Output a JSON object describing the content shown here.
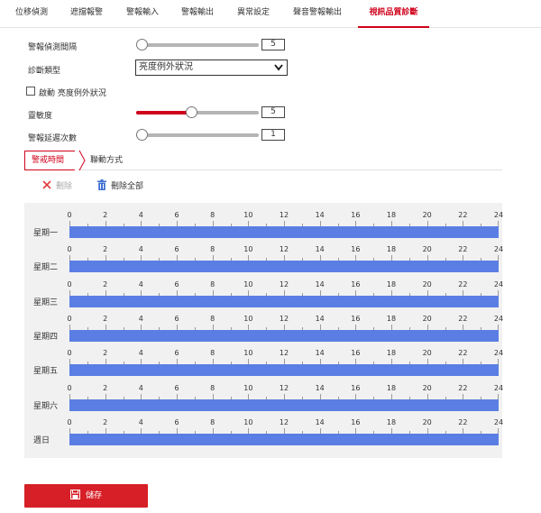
{
  "tabs": [
    {
      "label": "位移偵測",
      "active": false
    },
    {
      "label": "遮擋報警",
      "active": false
    },
    {
      "label": "警報輸入",
      "active": false
    },
    {
      "label": "警報輸出",
      "active": false
    },
    {
      "label": "異常設定",
      "active": false
    },
    {
      "label": "聲音警報輸出",
      "active": false
    },
    {
      "label": "視訊品質診斷",
      "active": true
    }
  ],
  "form": {
    "interval": {
      "label": "警報偵測間隔",
      "value": "5"
    },
    "diag_type": {
      "label": "診斷類型",
      "selected": "亮度例外狀況"
    },
    "enable": {
      "label": "啟動 亮度例外狀況",
      "checked": false
    },
    "sensitivity": {
      "label": "靈敏度",
      "value": "5"
    },
    "delay": {
      "label": "警報延遲次數",
      "value": "1"
    }
  },
  "subtabs": {
    "arming": "警戒時間",
    "linkage": "聯動方式"
  },
  "toolbar": {
    "delete": "刪除",
    "delete_all": "刪除全部"
  },
  "schedule": {
    "hour_labels": [
      "0",
      "2",
      "4",
      "6",
      "8",
      "10",
      "12",
      "14",
      "16",
      "18",
      "20",
      "22",
      "24"
    ],
    "days": [
      {
        "label": "星期一",
        "segments": [
          [
            0,
            24
          ]
        ]
      },
      {
        "label": "星期二",
        "segments": [
          [
            0,
            24
          ]
        ]
      },
      {
        "label": "星期三",
        "segments": [
          [
            0,
            24
          ]
        ]
      },
      {
        "label": "星期四",
        "segments": [
          [
            0,
            24
          ]
        ]
      },
      {
        "label": "星期五",
        "segments": [
          [
            0,
            24
          ]
        ]
      },
      {
        "label": "星期六",
        "segments": [
          [
            0,
            24
          ]
        ]
      },
      {
        "label": "週日",
        "segments": [
          [
            0,
            24
          ]
        ]
      }
    ]
  },
  "save_label": "儲存",
  "colors": {
    "accent": "#d0021b",
    "schedule_bar": "#5a7ee3",
    "delete_icon": "#e03a3a",
    "trash_icon": "#3f6fd1"
  }
}
